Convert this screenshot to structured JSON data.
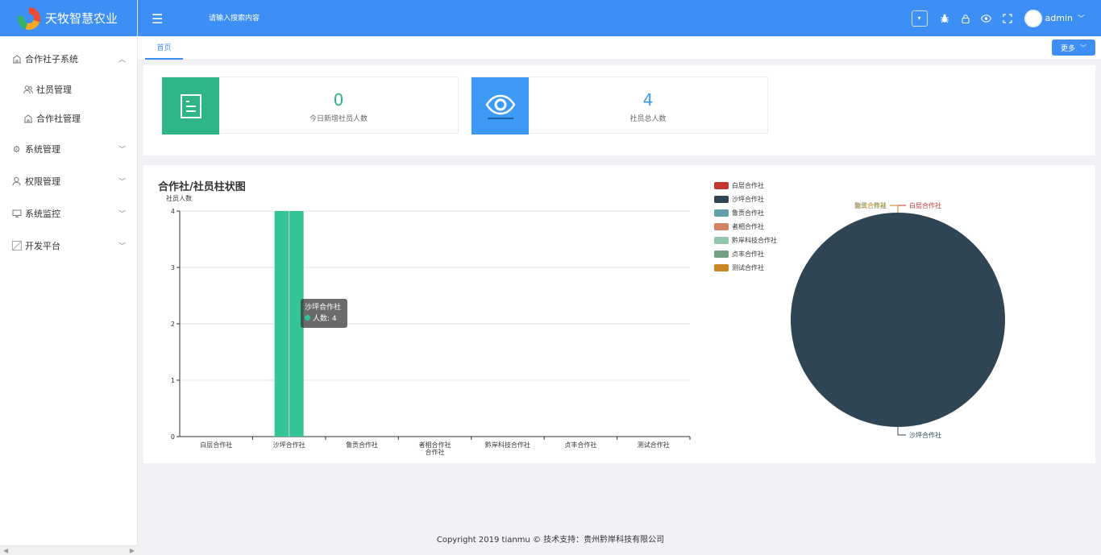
{
  "app": {
    "title": "天牧智慧农业"
  },
  "header": {
    "search_placeholder": "请输入搜索内容",
    "username": "admin",
    "icons": [
      "menu-icon",
      "dropdown-icon",
      "bug-icon",
      "lock-icon",
      "eye-icon",
      "fullscreen-icon",
      "avatar"
    ]
  },
  "sidebar": {
    "items": [
      {
        "label": "合作社子系统",
        "icon": "building-icon",
        "expanded": true
      },
      {
        "label": "社员管理",
        "icon": "users-icon",
        "sub": true
      },
      {
        "label": "合作社管理",
        "icon": "building-icon",
        "sub": true
      },
      {
        "label": "系统管理",
        "icon": "gear-icon"
      },
      {
        "label": "权限管理",
        "icon": "user-icon"
      },
      {
        "label": "系统监控",
        "icon": "monitor-icon"
      },
      {
        "label": "开发平台",
        "icon": "image-icon"
      }
    ]
  },
  "tabs": {
    "home": "首页",
    "more": "更多"
  },
  "stats": [
    {
      "value": "0",
      "label": "今日新增社员人数",
      "color": "#2eb488"
    },
    {
      "value": "4",
      "label": "社员总人数",
      "color": "#3c9af5"
    }
  ],
  "chart": {
    "title": "合作社/社员柱状图",
    "tooltip": {
      "title": "沙坪合作社",
      "line": "人数: 4"
    }
  },
  "chart_data": [
    {
      "type": "bar",
      "title": "合作社/社员柱状图",
      "ylabel": "社员人数",
      "xlabel": "",
      "categories": [
        "白层合作社",
        "沙坪合作社",
        "鲁贡合作社",
        "者相合作社",
        "黔岸科技合作社",
        "贞丰合作社",
        "测试合作社"
      ],
      "category_labels": [
        "白层合作社",
        "沙坪合作社",
        "鲁贡合作社",
        "者相合作社\n合作社",
        "黔岸科技合作社",
        "贞丰合作社",
        "测试合作社"
      ],
      "values": [
        0,
        4,
        0,
        0,
        0,
        0,
        0
      ],
      "yticks": [
        "0",
        "1",
        "2",
        "3",
        "4"
      ],
      "ylim": [
        0,
        4
      ],
      "bar_color": "#35c398",
      "grid": true
    },
    {
      "type": "pie",
      "legend": [
        "白层合作社",
        "沙坪合作社",
        "鲁贡合作社",
        "者相合作社",
        "黔岸科技合作社",
        "贞丰合作社",
        "测试合作社"
      ],
      "colors": [
        "#c23531",
        "#2f4554",
        "#61a0a8",
        "#d48265",
        "#91c7ae",
        "#749f83",
        "#ca8622"
      ],
      "values": [
        0,
        4,
        0,
        0,
        0,
        0,
        0
      ],
      "slice_labels": [
        {
          "text": "白层合作社",
          "color": "#c23531"
        },
        {
          "text": "沙坪合作社",
          "color": "#2f4554"
        },
        {
          "text": "黔岸",
          "color": "#91c7ae"
        },
        {
          "text": "鲁贡合作社",
          "color": "#61a0a8"
        },
        {
          "text": "测试合作社",
          "color": "#ca8622"
        }
      ],
      "legend_position": "top-left"
    }
  ],
  "footer": {
    "text": "Copyright 2019 tianmu © 技术支持：贵州黔岸科技有限公司"
  }
}
